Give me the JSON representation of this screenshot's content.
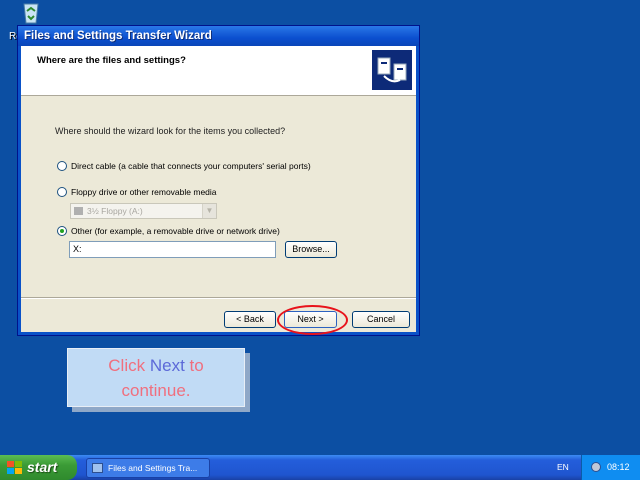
{
  "desktop": {
    "recycle_bin_label_visible": "Re",
    "recycle_bin_icon": "recycle-bin-icon"
  },
  "window": {
    "title": "Files and Settings Transfer Wizard",
    "header_title": "Where are the files and settings?",
    "header_icon": "transfer-wizard-icon",
    "question": "Where should the wizard look for the items you collected?",
    "options": {
      "direct_cable": {
        "label": "Direct cable (a cable that connects your computers' serial ports)",
        "selected": false
      },
      "floppy": {
        "label": "Floppy drive or other removable media",
        "selected": false
      },
      "other": {
        "label": "Other (for example, a removable drive or network drive)",
        "selected": true
      }
    },
    "floppy_select": {
      "value": "3½ Floppy (A:)",
      "disabled": true
    },
    "path_input": {
      "value": "X:"
    },
    "browse_label": "Browse...",
    "back_label": "< Back",
    "next_label": "Next >",
    "cancel_label": "Cancel",
    "highlight_color": "#e8131b"
  },
  "callout": {
    "prefix": "Click",
    "accent": "Next",
    "suffix": "to",
    "line2": "continue."
  },
  "taskbar": {
    "start_label": "start",
    "task_title": "Files and Settings Tra...",
    "language": "EN",
    "clock": "08:12"
  }
}
